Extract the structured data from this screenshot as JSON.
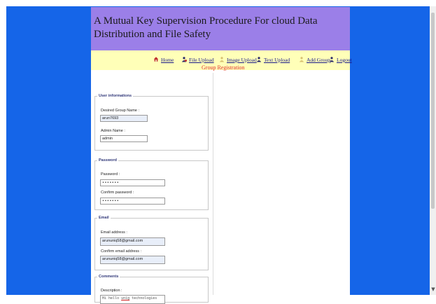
{
  "header": {
    "title": "A Mutual Key Supervision Procedure For cloud Data Distribution and File Safety"
  },
  "nav": {
    "items": [
      {
        "label": "Home",
        "icon": "home-icon"
      },
      {
        "label": "File Upload",
        "icon": "user-icon"
      },
      {
        "label": "Image Upload",
        "icon": "user-icon"
      },
      {
        "label": "Text Upload",
        "icon": "user-icon"
      },
      {
        "label": "Add Group",
        "icon": "user-icon"
      },
      {
        "label": "Logout",
        "icon": "user-icon"
      }
    ]
  },
  "page": {
    "title": "Group Registration"
  },
  "user_info": {
    "legend": "User informations",
    "group_name_label": "Desired Group Name :",
    "group_name_value": "arun7693",
    "admin_name_label": "Admin Name :",
    "admin_name_value": "admin"
  },
  "password": {
    "legend": "Password",
    "password_label": "Password :",
    "password_value": "•••••••",
    "confirm_label": "Confirm password :",
    "confirm_value": "•••••••"
  },
  "email": {
    "legend": "Email",
    "email_label": "Email address :",
    "email_value": "arununiq58@gmail.com",
    "confirm_label": "Confirm email address :",
    "confirm_value": "arununiq58@gmail.com"
  },
  "comments": {
    "legend": "Comments",
    "description_label": "Description :",
    "description_prefix": "Hi hello ",
    "description_word": "unig",
    "description_suffix": " technologies"
  },
  "colors": {
    "background": "#1565e8",
    "header": "#9b7fe8",
    "navbar": "#ffffb8",
    "title_red": "#e03030"
  }
}
